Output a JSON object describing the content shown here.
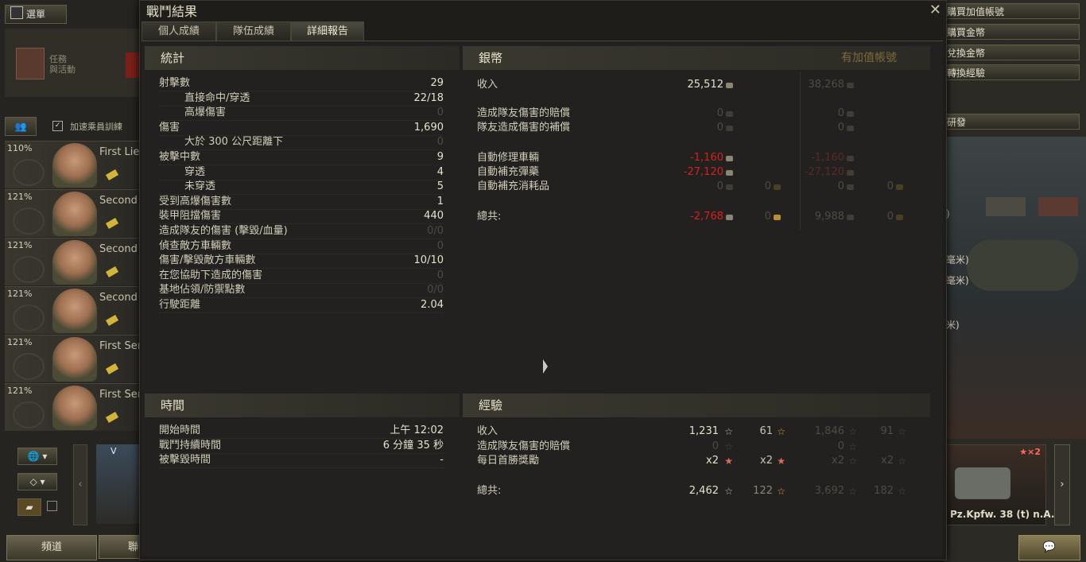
{
  "left": {
    "menu_label": "選單",
    "mission_label": "任務\n與活動",
    "accelerate_label": "加速乘員訓練",
    "crew": [
      {
        "pct": "110%",
        "rank": "First Lie"
      },
      {
        "pct": "121%",
        "rank": "Second"
      },
      {
        "pct": "121%",
        "rank": "Second"
      },
      {
        "pct": "121%",
        "rank": "Second"
      },
      {
        "pct": "121%",
        "rank": "First Ser"
      },
      {
        "pct": "121%",
        "rank": "First Ser"
      }
    ],
    "channel_label": "頻道",
    "contacts_label": "聯",
    "tank_tier": "V"
  },
  "right": {
    "buttons": [
      "購買加值帳號",
      "購買金幣",
      "兌換金幣",
      "轉換經驗"
    ],
    "research": "研發",
    "garage_labels": [
      ")",
      "毫米)",
      "毫米)",
      "米)"
    ],
    "tank_name": "Pz.Kpfw. 38 (t) n.A.",
    "tank_mult": "★×2"
  },
  "dialog": {
    "title": "戰鬥結果",
    "tabs": [
      "個人成績",
      "隊伍成績",
      "詳細報告"
    ],
    "stats": {
      "title": "統計",
      "rows": [
        {
          "label": "射擊數",
          "value": "29",
          "indent": false,
          "dim": false
        },
        {
          "label": "直接命中/穿透",
          "value": "22/18",
          "indent": true,
          "dim": false
        },
        {
          "label": "高爆傷害",
          "value": "0",
          "indent": true,
          "dim": true
        },
        {
          "label": "傷害",
          "value": "1,690",
          "indent": false,
          "dim": false
        },
        {
          "label": "大於 300 公尺距離下",
          "value": "0",
          "indent": true,
          "dim": true
        },
        {
          "label": "被擊中數",
          "value": "9",
          "indent": false,
          "dim": false
        },
        {
          "label": "穿透",
          "value": "4",
          "indent": true,
          "dim": false
        },
        {
          "label": "未穿透",
          "value": "5",
          "indent": true,
          "dim": false
        },
        {
          "label": "受到高爆傷害數",
          "value": "1",
          "indent": false,
          "dim": false
        },
        {
          "label": "裝甲阻擋傷害",
          "value": "440",
          "indent": false,
          "dim": false
        },
        {
          "label": "造成隊友的傷害 (擊毀/血量)",
          "value": "0/0",
          "indent": false,
          "dim": true
        },
        {
          "label": "偵查敵方車輛數",
          "value": "0",
          "indent": false,
          "dim": true
        },
        {
          "label": "傷害/擊毀敵方車輛數",
          "value": "10/10",
          "indent": false,
          "dim": false
        },
        {
          "label": "在您協助下造成的傷害",
          "value": "0",
          "indent": false,
          "dim": true
        },
        {
          "label": "基地佔領/防禦點數",
          "value": "0/0",
          "indent": false,
          "dim": true
        },
        {
          "label": "行駛距離",
          "value": "2.04",
          "indent": false,
          "dim": false
        }
      ]
    },
    "credits": {
      "title": "銀幣",
      "premium_label": "有加值帳號",
      "rows": [
        {
          "label": "收入",
          "v1": "25,512",
          "g1": "",
          "v2": "38,268",
          "g2": "",
          "style": "normal"
        },
        {
          "label": "造成隊友傷害的賠償",
          "v1": "0",
          "g1": "",
          "v2": "0",
          "g2": "",
          "style": "dim"
        },
        {
          "label": "隊友造成傷害的補償",
          "v1": "0",
          "g1": "",
          "v2": "0",
          "g2": "",
          "style": "dim"
        },
        {
          "label": "自動修理車輛",
          "v1": "-1,160",
          "g1": "",
          "v2": "-1,160",
          "g2": "",
          "style": "neg"
        },
        {
          "label": "自動補充彈藥",
          "v1": "-27,120",
          "g1": "",
          "v2": "-27,120",
          "g2": "",
          "style": "neg"
        },
        {
          "label": "自動補充消耗品",
          "v1": "0",
          "g1": "0",
          "v2": "0",
          "g2": "0",
          "style": "dim"
        },
        {
          "label": "總共:",
          "v1": "-2,768",
          "g1": "0",
          "v2": "9,988",
          "g2": "0",
          "style": "total"
        }
      ]
    },
    "time": {
      "title": "時間",
      "rows": [
        {
          "label": "開始時間",
          "value": "上午 12:02"
        },
        {
          "label": "戰鬥持續時間",
          "value": "6 分鐘 35 秒"
        },
        {
          "label": "被擊毀時間",
          "value": "-"
        }
      ]
    },
    "xp": {
      "title": "經驗",
      "rows": [
        {
          "label": "收入",
          "v1": "1,231",
          "f1": "61",
          "v2": "1,846",
          "f2": "91",
          "style": "normal"
        },
        {
          "label": "造成隊友傷害的賠償",
          "v1": "0",
          "f1": "",
          "v2": "0",
          "f2": "",
          "style": "dim"
        },
        {
          "label": "每日首勝獎勵",
          "v1": "x2",
          "f1": "x2",
          "v2": "x2",
          "f2": "x2",
          "style": "mult"
        },
        {
          "label": "總共:",
          "v1": "2,462",
          "f1": "122",
          "v2": "3,692",
          "f2": "182",
          "style": "total"
        }
      ]
    }
  },
  "colors": {
    "negative": "#d6211a",
    "premium": "#7f6a3a",
    "background": "#222120"
  }
}
